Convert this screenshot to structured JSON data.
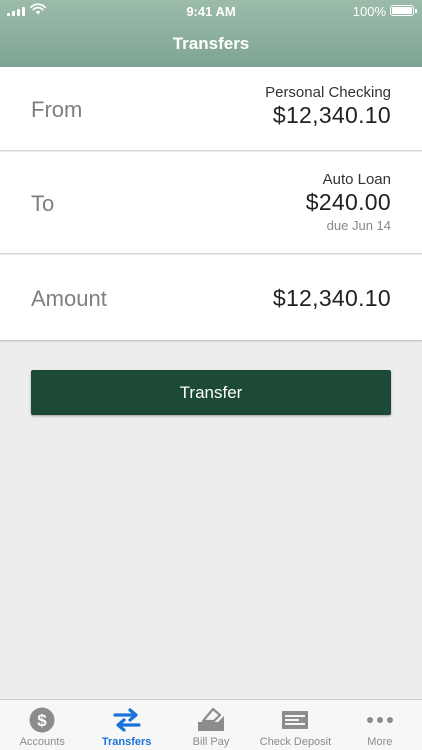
{
  "status_bar": {
    "time": "9:41 AM",
    "battery": "100%"
  },
  "header": {
    "title": "Transfers"
  },
  "from": {
    "label": "From",
    "account": "Personal Checking",
    "amount": "$12,340.10"
  },
  "to": {
    "label": "To",
    "account": "Auto Loan",
    "amount": "$240.00",
    "due": "due Jun 14"
  },
  "amount": {
    "label": "Amount",
    "value": "$12,340.10"
  },
  "transfer_button": {
    "label": "Transfer"
  },
  "tabs": [
    {
      "label": "Accounts",
      "icon": "dollar-circle-icon",
      "active": false
    },
    {
      "label": "Transfers",
      "icon": "transfer-arrows-icon",
      "active": true
    },
    {
      "label": "Bill Pay",
      "icon": "bill-pay-icon",
      "active": false
    },
    {
      "label": "Check Deposit",
      "icon": "check-icon",
      "active": false
    },
    {
      "label": "More",
      "icon": "more-dots-icon",
      "active": false
    }
  ],
  "colors": {
    "header": "#8fb09f",
    "primary_button": "#1c4a36",
    "tab_active": "#1a73d9",
    "tab_inactive": "#8c8c8c"
  }
}
